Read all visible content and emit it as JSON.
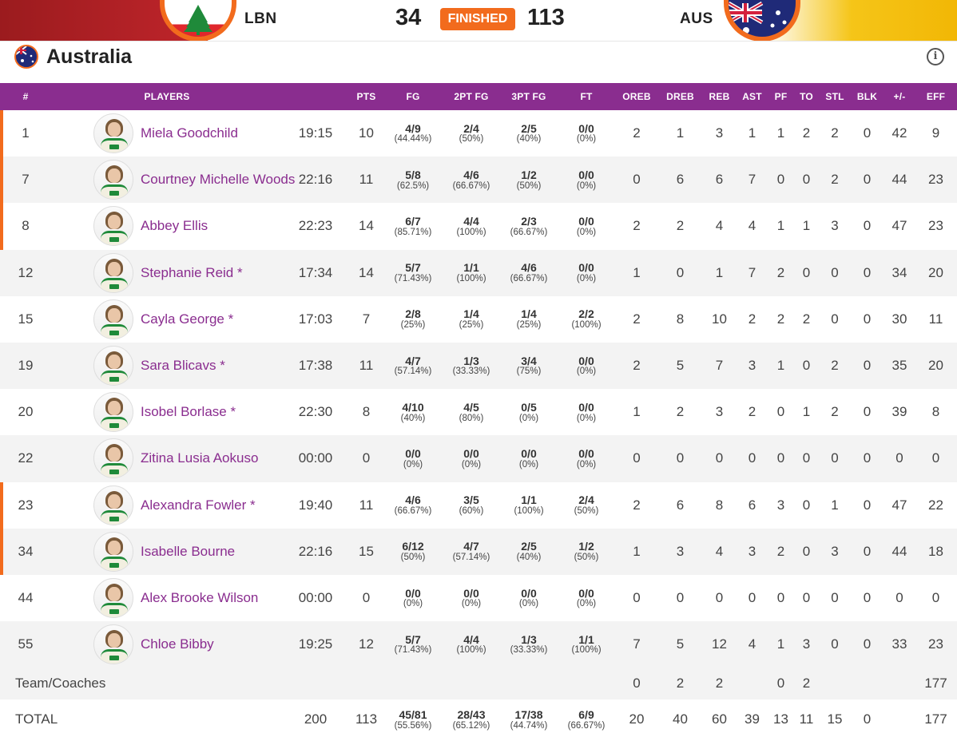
{
  "scoreboard": {
    "home": {
      "code": "LBN",
      "score": "34"
    },
    "away": {
      "code": "AUS",
      "score": "113"
    },
    "status": "FINISHED"
  },
  "team": {
    "name": "Australia"
  },
  "columns": [
    "#",
    "PLAYERS",
    "",
    "PTS",
    "FG",
    "2PT FG",
    "3PT FG",
    "FT",
    "OREB",
    "DREB",
    "REB",
    "AST",
    "PF",
    "TO",
    "STL",
    "BLK",
    "+/-",
    "EFF"
  ],
  "players": [
    {
      "num": "1",
      "name": "Miela Goodchild",
      "min": "19:15",
      "pts": "10",
      "fg": "4/9",
      "fg_pct": "(44.44%)",
      "fg2": "2/4",
      "fg2_pct": "(50%)",
      "fg3": "2/5",
      "fg3_pct": "(40%)",
      "ft": "0/0",
      "ft_pct": "(0%)",
      "oreb": "2",
      "dreb": "1",
      "reb": "3",
      "ast": "1",
      "pf": "1",
      "to": "2",
      "stl": "2",
      "blk": "0",
      "pm": "42",
      "eff": "9",
      "starter": true
    },
    {
      "num": "7",
      "name": "Courtney Michelle Woods",
      "min": "22:16",
      "pts": "11",
      "fg": "5/8",
      "fg_pct": "(62.5%)",
      "fg2": "4/6",
      "fg2_pct": "(66.67%)",
      "fg3": "1/2",
      "fg3_pct": "(50%)",
      "ft": "0/0",
      "ft_pct": "(0%)",
      "oreb": "0",
      "dreb": "6",
      "reb": "6",
      "ast": "7",
      "pf": "0",
      "to": "0",
      "stl": "2",
      "blk": "0",
      "pm": "44",
      "eff": "23",
      "starter": true
    },
    {
      "num": "8",
      "name": "Abbey Ellis",
      "min": "22:23",
      "pts": "14",
      "fg": "6/7",
      "fg_pct": "(85.71%)",
      "fg2": "4/4",
      "fg2_pct": "(100%)",
      "fg3": "2/3",
      "fg3_pct": "(66.67%)",
      "ft": "0/0",
      "ft_pct": "(0%)",
      "oreb": "2",
      "dreb": "2",
      "reb": "4",
      "ast": "4",
      "pf": "1",
      "to": "1",
      "stl": "3",
      "blk": "0",
      "pm": "47",
      "eff": "23",
      "starter": true
    },
    {
      "num": "12",
      "name": "Stephanie Reid *",
      "min": "17:34",
      "pts": "14",
      "fg": "5/7",
      "fg_pct": "(71.43%)",
      "fg2": "1/1",
      "fg2_pct": "(100%)",
      "fg3": "4/6",
      "fg3_pct": "(66.67%)",
      "ft": "0/0",
      "ft_pct": "(0%)",
      "oreb": "1",
      "dreb": "0",
      "reb": "1",
      "ast": "7",
      "pf": "2",
      "to": "0",
      "stl": "0",
      "blk": "0",
      "pm": "34",
      "eff": "20",
      "starter": false
    },
    {
      "num": "15",
      "name": "Cayla George *",
      "min": "17:03",
      "pts": "7",
      "fg": "2/8",
      "fg_pct": "(25%)",
      "fg2": "1/4",
      "fg2_pct": "(25%)",
      "fg3": "1/4",
      "fg3_pct": "(25%)",
      "ft": "2/2",
      "ft_pct": "(100%)",
      "oreb": "2",
      "dreb": "8",
      "reb": "10",
      "ast": "2",
      "pf": "2",
      "to": "2",
      "stl": "0",
      "blk": "0",
      "pm": "30",
      "eff": "11",
      "starter": false
    },
    {
      "num": "19",
      "name": "Sara Blicavs *",
      "min": "17:38",
      "pts": "11",
      "fg": "4/7",
      "fg_pct": "(57.14%)",
      "fg2": "1/3",
      "fg2_pct": "(33.33%)",
      "fg3": "3/4",
      "fg3_pct": "(75%)",
      "ft": "0/0",
      "ft_pct": "(0%)",
      "oreb": "2",
      "dreb": "5",
      "reb": "7",
      "ast": "3",
      "pf": "1",
      "to": "0",
      "stl": "2",
      "blk": "0",
      "pm": "35",
      "eff": "20",
      "starter": false
    },
    {
      "num": "20",
      "name": "Isobel Borlase *",
      "min": "22:30",
      "pts": "8",
      "fg": "4/10",
      "fg_pct": "(40%)",
      "fg2": "4/5",
      "fg2_pct": "(80%)",
      "fg3": "0/5",
      "fg3_pct": "(0%)",
      "ft": "0/0",
      "ft_pct": "(0%)",
      "oreb": "1",
      "dreb": "2",
      "reb": "3",
      "ast": "2",
      "pf": "0",
      "to": "1",
      "stl": "2",
      "blk": "0",
      "pm": "39",
      "eff": "8",
      "starter": false
    },
    {
      "num": "22",
      "name": "Zitina Lusia Aokuso",
      "min": "00:00",
      "pts": "0",
      "fg": "0/0",
      "fg_pct": "(0%)",
      "fg2": "0/0",
      "fg2_pct": "(0%)",
      "fg3": "0/0",
      "fg3_pct": "(0%)",
      "ft": "0/0",
      "ft_pct": "(0%)",
      "oreb": "0",
      "dreb": "0",
      "reb": "0",
      "ast": "0",
      "pf": "0",
      "to": "0",
      "stl": "0",
      "blk": "0",
      "pm": "0",
      "eff": "0",
      "starter": false
    },
    {
      "num": "23",
      "name": "Alexandra Fowler *",
      "min": "19:40",
      "pts": "11",
      "fg": "4/6",
      "fg_pct": "(66.67%)",
      "fg2": "3/5",
      "fg2_pct": "(60%)",
      "fg3": "1/1",
      "fg3_pct": "(100%)",
      "ft": "2/4",
      "ft_pct": "(50%)",
      "oreb": "2",
      "dreb": "6",
      "reb": "8",
      "ast": "6",
      "pf": "3",
      "to": "0",
      "stl": "1",
      "blk": "0",
      "pm": "47",
      "eff": "22",
      "starter": true
    },
    {
      "num": "34",
      "name": "Isabelle Bourne",
      "min": "22:16",
      "pts": "15",
      "fg": "6/12",
      "fg_pct": "(50%)",
      "fg2": "4/7",
      "fg2_pct": "(57.14%)",
      "fg3": "2/5",
      "fg3_pct": "(40%)",
      "ft": "1/2",
      "ft_pct": "(50%)",
      "oreb": "1",
      "dreb": "3",
      "reb": "4",
      "ast": "3",
      "pf": "2",
      "to": "0",
      "stl": "3",
      "blk": "0",
      "pm": "44",
      "eff": "18",
      "starter": true
    },
    {
      "num": "44",
      "name": "Alex Brooke Wilson",
      "min": "00:00",
      "pts": "0",
      "fg": "0/0",
      "fg_pct": "(0%)",
      "fg2": "0/0",
      "fg2_pct": "(0%)",
      "fg3": "0/0",
      "fg3_pct": "(0%)",
      "ft": "0/0",
      "ft_pct": "(0%)",
      "oreb": "0",
      "dreb": "0",
      "reb": "0",
      "ast": "0",
      "pf": "0",
      "to": "0",
      "stl": "0",
      "blk": "0",
      "pm": "0",
      "eff": "0",
      "starter": false
    },
    {
      "num": "55",
      "name": "Chloe Bibby",
      "min": "19:25",
      "pts": "12",
      "fg": "5/7",
      "fg_pct": "(71.43%)",
      "fg2": "4/4",
      "fg2_pct": "(100%)",
      "fg3": "1/3",
      "fg3_pct": "(33.33%)",
      "ft": "1/1",
      "ft_pct": "(100%)",
      "oreb": "7",
      "dreb": "5",
      "reb": "12",
      "ast": "4",
      "pf": "1",
      "to": "3",
      "stl": "0",
      "blk": "0",
      "pm": "33",
      "eff": "23",
      "starter": false
    }
  ],
  "team_row": {
    "label": "Team/Coaches",
    "oreb": "0",
    "dreb": "2",
    "reb": "2",
    "ast": "",
    "pf": "0",
    "to": "2",
    "stl": "",
    "blk": "",
    "pm": "",
    "eff": "177"
  },
  "total_row": {
    "label": "TOTAL",
    "min": "200",
    "pts": "113",
    "fg": "45/81",
    "fg_pct": "(55.56%)",
    "fg2": "28/43",
    "fg2_pct": "(65.12%)",
    "fg3": "17/38",
    "fg3_pct": "(44.74%)",
    "ft": "6/9",
    "ft_pct": "(66.67%)",
    "oreb": "20",
    "dreb": "40",
    "reb": "60",
    "ast": "39",
    "pf": "13",
    "to": "11",
    "stl": "15",
    "blk": "0",
    "pm": "",
    "eff": "177"
  },
  "colors": {
    "header_purple": "#8a2d8f",
    "accent_orange": "#f26b1d",
    "player_link": "#8a2d8f"
  },
  "icons": {
    "info": "info-icon",
    "lbn_flag": "lebanon-flag-icon",
    "aus_flag": "australia-flag-icon"
  }
}
